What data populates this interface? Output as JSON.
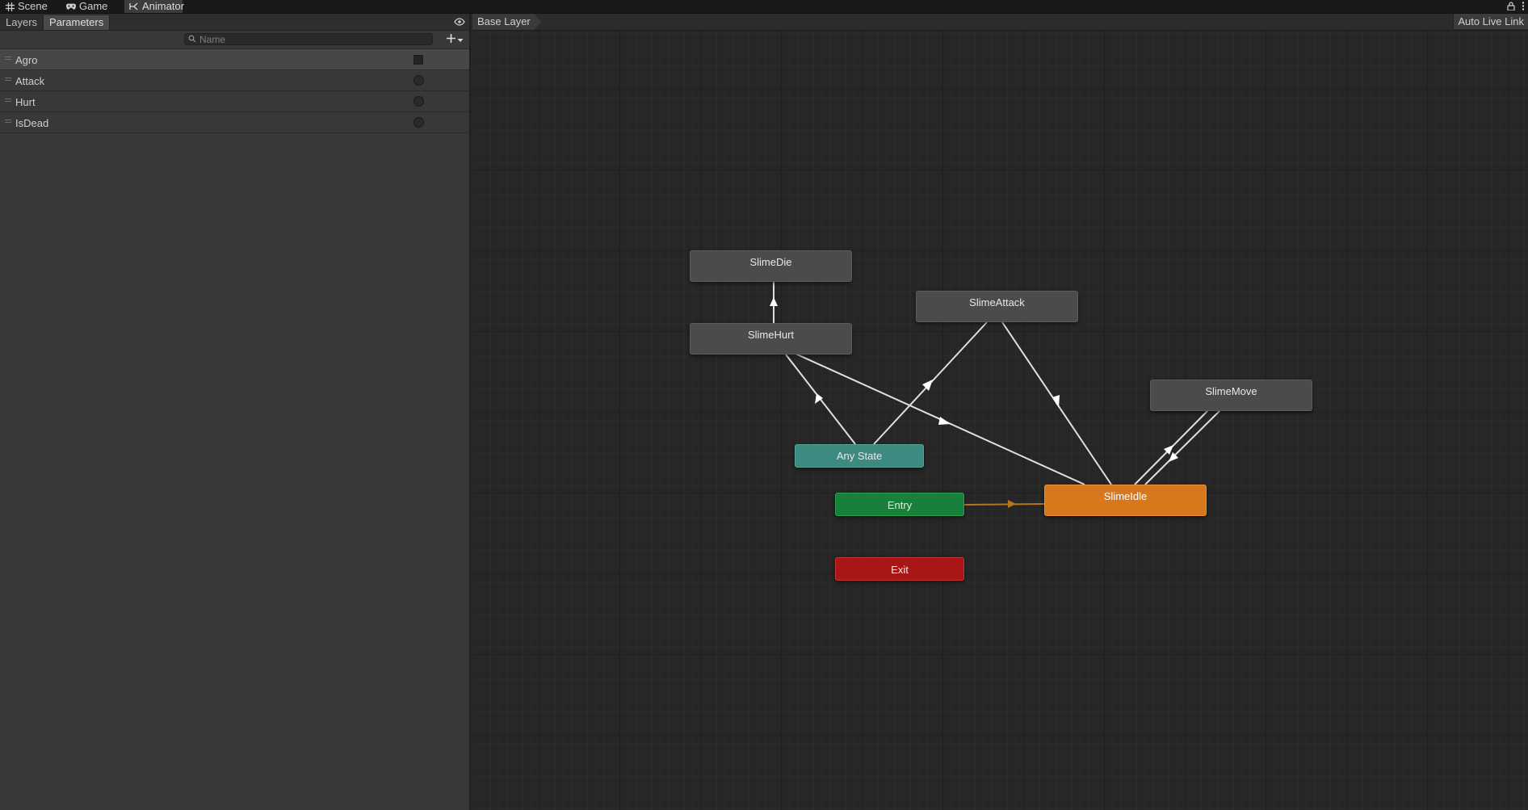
{
  "tabs": [
    {
      "label": "Scene",
      "icon": "grid-icon"
    },
    {
      "label": "Game",
      "icon": "gamepad-icon"
    },
    {
      "label": "Animator",
      "icon": "animator-icon"
    }
  ],
  "left_panel": {
    "subtabs": [
      "Layers",
      "Parameters"
    ],
    "active_subtab": "Parameters",
    "search": {
      "placeholder": "Name",
      "value": ""
    },
    "parameters": [
      {
        "name": "Agro",
        "type": "bool",
        "value": false
      },
      {
        "name": "Attack",
        "type": "trigger"
      },
      {
        "name": "Hurt",
        "type": "trigger"
      },
      {
        "name": "IsDead",
        "type": "trigger"
      }
    ]
  },
  "graph": {
    "breadcrumb": "Base Layer",
    "live_link_label": "Auto Live Link",
    "states": {
      "slime_die": "SlimeDie",
      "slime_hurt": "SlimeHurt",
      "slime_attack": "SlimeAttack",
      "slime_move": "SlimeMove",
      "slime_idle": "SlimeIdle",
      "any_state": "Any State",
      "entry": "Entry",
      "exit": "Exit"
    },
    "transitions": [
      {
        "from": "SlimeHurt",
        "to": "SlimeDie"
      },
      {
        "from": "Any State",
        "to": "SlimeHurt"
      },
      {
        "from": "Any State",
        "to": "SlimeAttack"
      },
      {
        "from": "SlimeHurt",
        "to": "SlimeIdle"
      },
      {
        "from": "SlimeAttack",
        "to": "SlimeIdle"
      },
      {
        "from": "SlimeIdle",
        "to": "SlimeMove"
      },
      {
        "from": "SlimeMove",
        "to": "SlimeIdle"
      },
      {
        "from": "Entry",
        "to": "SlimeIdle",
        "default": true
      }
    ],
    "colors": {
      "default_state": "#d8781c",
      "any_state": "#3d8a80",
      "entry": "#18803a",
      "exit": "#a81616",
      "state": "#4a4b4d",
      "transition": "#e0e0e0",
      "default_transition": "#b7761e"
    }
  }
}
